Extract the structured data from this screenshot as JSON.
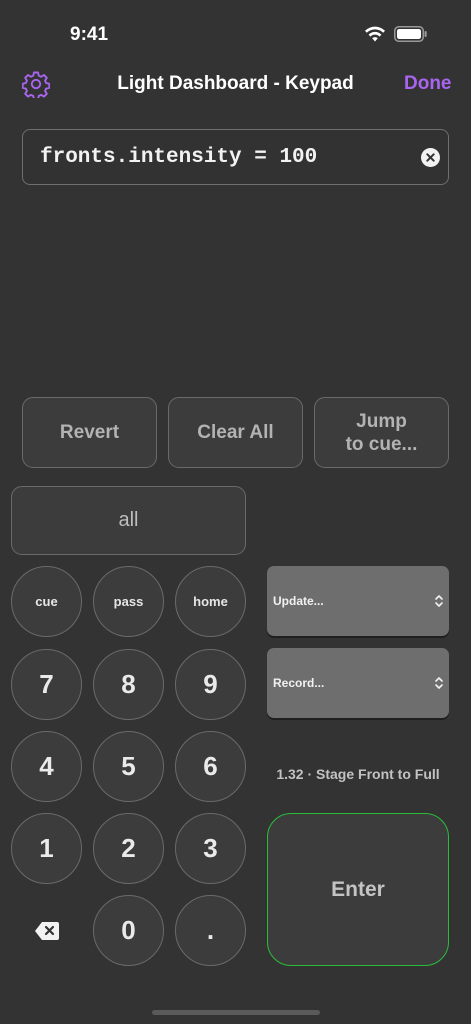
{
  "status_bar": {
    "time": "9:41"
  },
  "nav": {
    "title": "Light Dashboard - Keypad",
    "done_label": "Done",
    "accent": "#a865f0"
  },
  "command": {
    "value": "fronts.intensity = 100"
  },
  "actions": {
    "revert_label": "Revert",
    "clear_all_label": "Clear All",
    "jump_line1": "Jump",
    "jump_line2": "to cue..."
  },
  "keypad": {
    "all_label": "all",
    "cue_label": "cue",
    "pass_label": "pass",
    "home_label": "home",
    "digits": {
      "seven": "7",
      "eight": "8",
      "nine": "9",
      "four": "4",
      "five": "5",
      "six": "6",
      "one": "1",
      "two": "2",
      "three": "3",
      "zero": "0",
      "dot": "."
    }
  },
  "selects": {
    "update_label": "Update...",
    "record_label": "Record..."
  },
  "current_cue": "1.32 · Stage Front to Full",
  "enter_label": "Enter",
  "colors": {
    "background": "#333333",
    "enter_border": "#2bbd3a",
    "select_bg": "#6e6e6e"
  }
}
